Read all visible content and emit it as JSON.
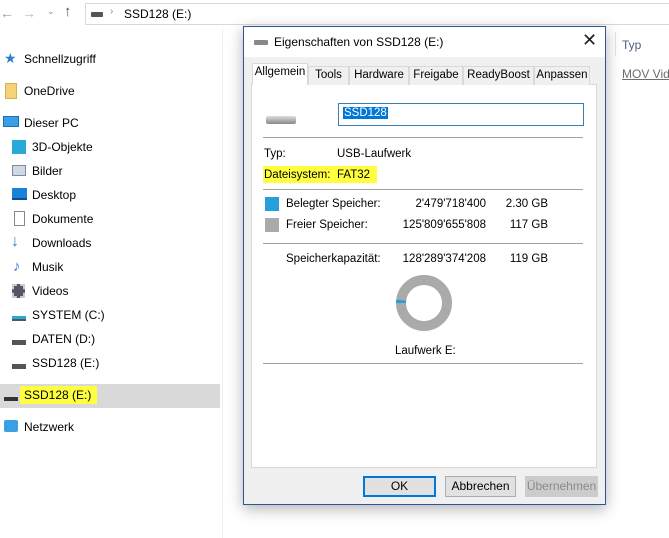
{
  "explorer": {
    "address": {
      "path": "SSD128 (E:)"
    },
    "sidebar": {
      "items": [
        {
          "label": "Schnellzugriff",
          "icon": "star-icon"
        },
        {
          "label": "OneDrive",
          "icon": "folder-icon"
        },
        {
          "label": "Dieser PC",
          "icon": "monitor-icon"
        },
        {
          "label": "3D-Objekte",
          "icon": "cube-icon"
        },
        {
          "label": "Bilder",
          "icon": "picture-icon"
        },
        {
          "label": "Desktop",
          "icon": "desktop-icon"
        },
        {
          "label": "Dokumente",
          "icon": "document-icon"
        },
        {
          "label": "Downloads",
          "icon": "download-arrow-icon"
        },
        {
          "label": "Musik",
          "icon": "music-note-icon"
        },
        {
          "label": "Videos",
          "icon": "film-icon"
        },
        {
          "label": "SYSTEM (C:)",
          "icon": "drive-icon"
        },
        {
          "label": "DATEN (D:)",
          "icon": "drive-icon"
        },
        {
          "label": "SSD128 (E:)",
          "icon": "drive-icon"
        },
        {
          "label": "SSD128 (E:)",
          "icon": "usb-drive-icon",
          "selected": true
        },
        {
          "label": "Netzwerk",
          "icon": "network-icon"
        }
      ]
    },
    "columns": {
      "type_header": "Typ"
    },
    "rows": [
      {
        "type": "MOV Vid"
      }
    ]
  },
  "dialog": {
    "title": "Eigenschaften von SSD128 (E:)",
    "tabs": [
      "Allgemein",
      "Tools",
      "Hardware",
      "Freigabe",
      "ReadyBoost",
      "Anpassen"
    ],
    "active_tab": "Allgemein",
    "name_value": "SSD128",
    "type_label": "Typ:",
    "type_value": "USB-Laufwerk",
    "fs_label": "Dateisystem:",
    "fs_value": "FAT32",
    "used": {
      "label": "Belegter Speicher:",
      "bytes": "2'479'718'400",
      "size": "2.30 GB",
      "color": "#26a0da"
    },
    "free": {
      "label": "Freier Speicher:",
      "bytes": "125'809'655'808",
      "size": "117 GB",
      "color": "#aaaaaa"
    },
    "capacity": {
      "label": "Speicherkapazität:",
      "bytes": "128'289'374'208",
      "size": "119 GB"
    },
    "used_fraction": 0.0193,
    "drive_label": "Laufwerk E:",
    "buttons": {
      "ok": "OK",
      "cancel": "Abbrechen",
      "apply": "Übernehmen"
    }
  },
  "highlight_color": "#ffff40"
}
